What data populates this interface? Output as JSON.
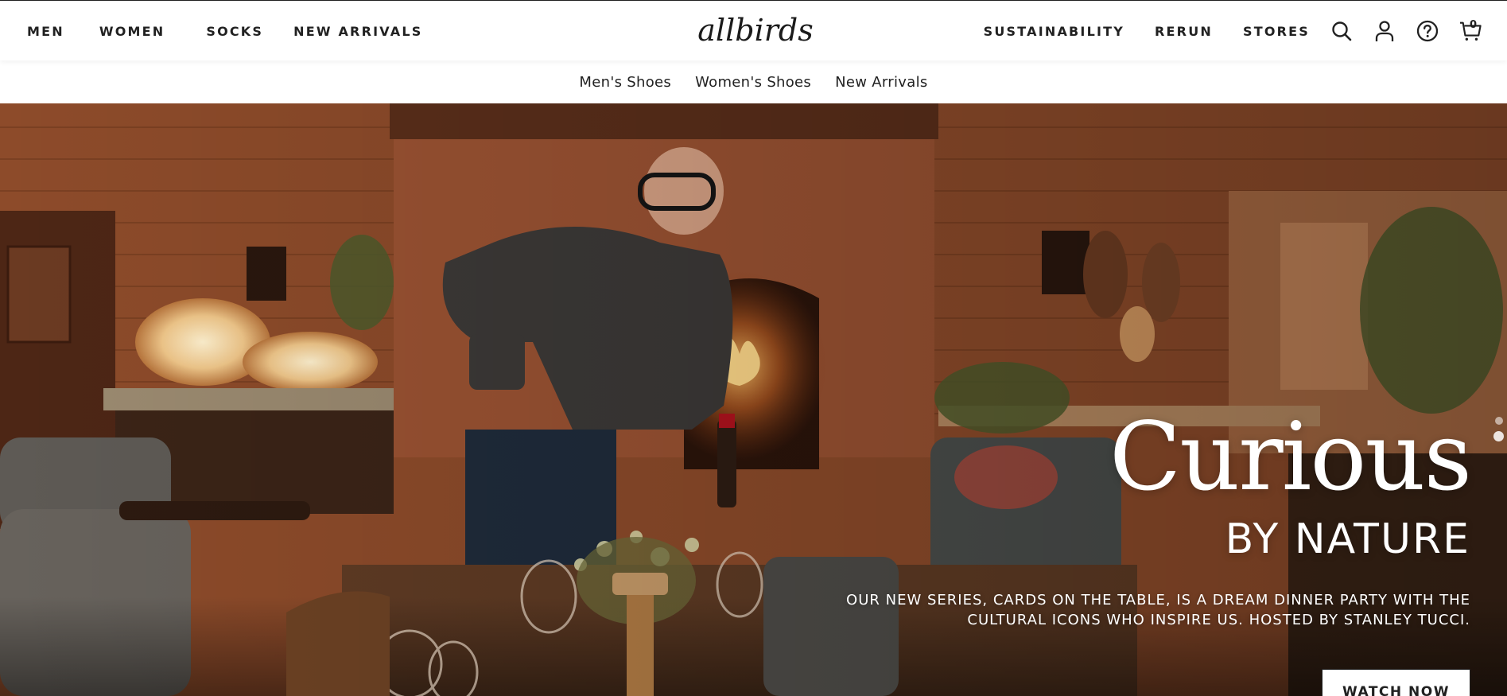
{
  "nav": {
    "left": [
      "MEN",
      "WOMEN",
      "SOCKS",
      "NEW ARRIVALS"
    ],
    "logo": "allbirds",
    "right": [
      "SUSTAINABILITY",
      "RERUN",
      "STORES"
    ],
    "icons": [
      "search-icon",
      "account-icon",
      "help-icon",
      "cart-icon"
    ],
    "cart_count": "0"
  },
  "subnav": [
    "Men's Shoes",
    "Women's Shoes",
    "New Arrivals"
  ],
  "hero": {
    "title": "Curious",
    "subtitle": "BY NATURE",
    "description_line1": "OUR NEW SERIES, CARDS ON THE TABLE, IS A DREAM DINNER PARTY WITH THE",
    "description_line2": "CULTURAL ICONS WHO INSPIRE US. HOSTED BY STANLEY TUCCI.",
    "cta": "WATCH NOW",
    "slide_indicator": {
      "count": 2,
      "active": 2
    }
  },
  "colors": {
    "text": "#212121",
    "hero_warm": "#8a4a27",
    "white": "#ffffff"
  }
}
